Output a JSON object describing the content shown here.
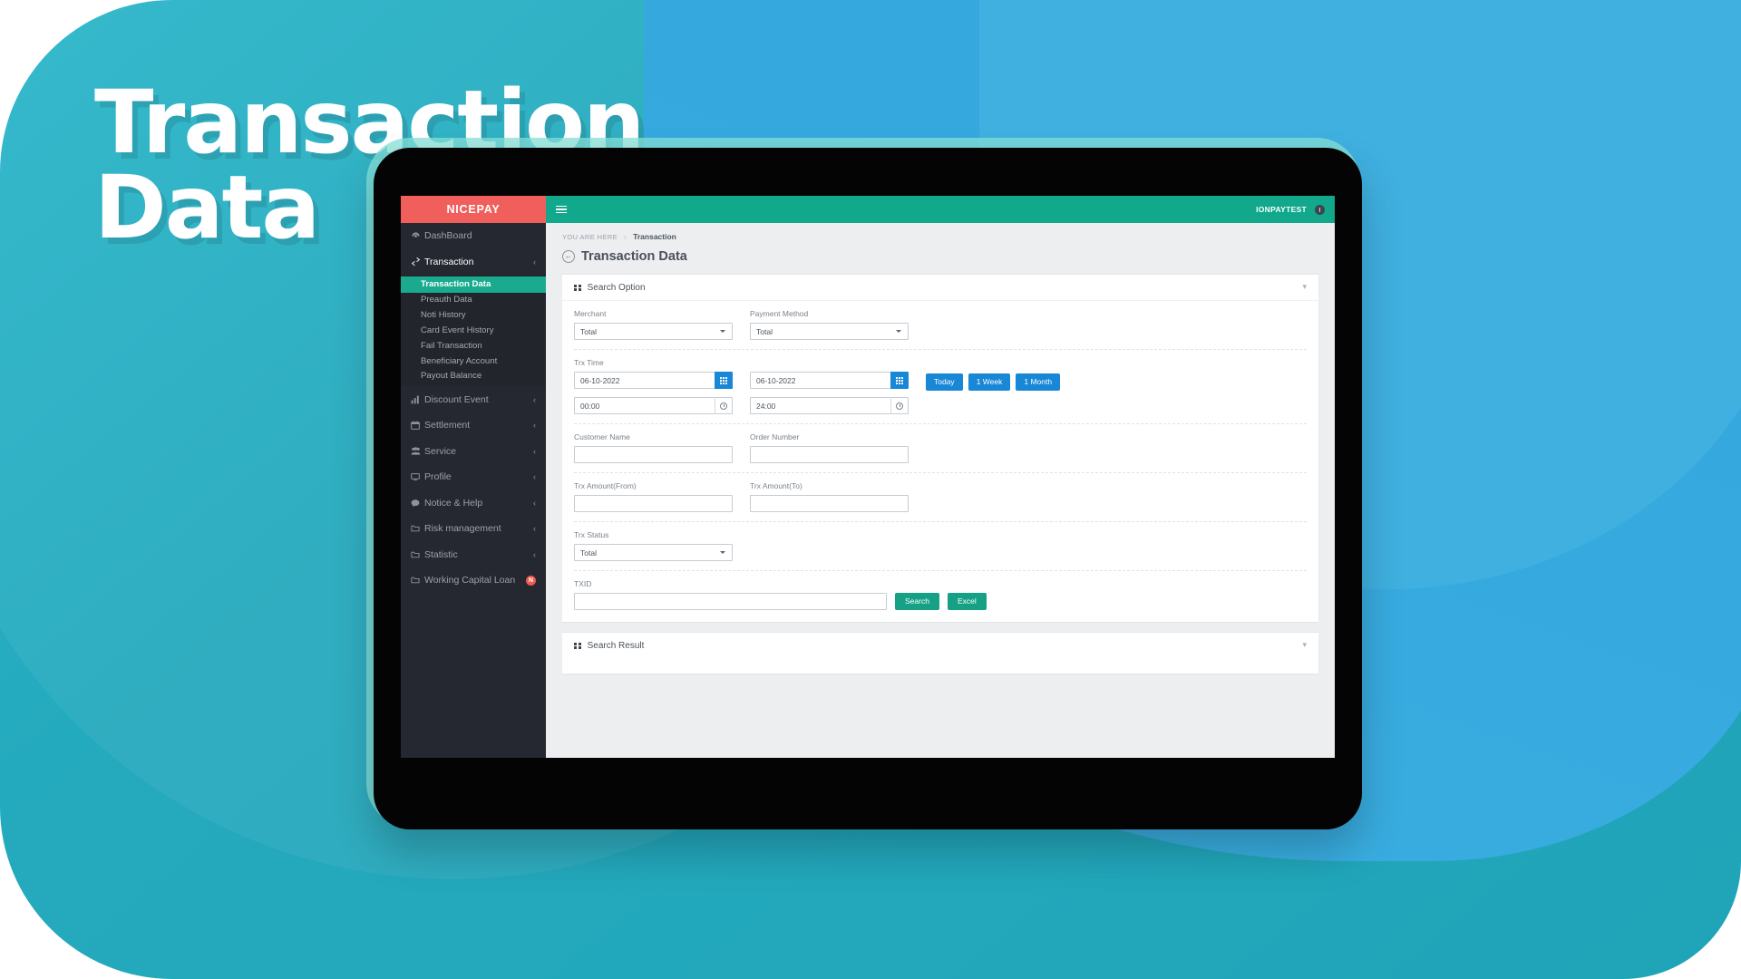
{
  "hero": {
    "line1": "Transaction",
    "line2": "Data"
  },
  "brand": {
    "name": "NICEPAY"
  },
  "topbar": {
    "menu_icon": "hamburger-icon",
    "user": "IONPAYTEST",
    "power_icon": "power-icon"
  },
  "sidebar": {
    "items": [
      {
        "label": "DashBoard",
        "icon": "dashboard-icon",
        "caret": ""
      },
      {
        "label": "Transaction",
        "icon": "transaction-icon",
        "caret": "‹"
      },
      {
        "label": "Discount Event",
        "icon": "chart-bar-icon",
        "caret": "‹"
      },
      {
        "label": "Settlement",
        "icon": "calendar-icon",
        "caret": "‹"
      },
      {
        "label": "Service",
        "icon": "users-icon",
        "caret": "‹"
      },
      {
        "label": "Profile",
        "icon": "monitor-icon",
        "caret": "‹"
      },
      {
        "label": "Notice & Help",
        "icon": "comment-icon",
        "caret": "‹"
      },
      {
        "label": "Risk management",
        "icon": "folder-icon",
        "caret": "‹"
      },
      {
        "label": "Statistic",
        "icon": "folder-icon",
        "caret": "‹"
      },
      {
        "label": "Working Capital Loan",
        "icon": "folder-icon",
        "caret": "",
        "badge": "N"
      }
    ],
    "submenu": [
      {
        "label": "Transaction Data",
        "selected": true
      },
      {
        "label": "Preauth Data",
        "selected": false
      },
      {
        "label": "Noti History",
        "selected": false
      },
      {
        "label": "Card Event History",
        "selected": false
      },
      {
        "label": "Fail Transaction",
        "selected": false
      },
      {
        "label": "Beneficiary Account",
        "selected": false
      },
      {
        "label": "Payout Balance",
        "selected": false
      }
    ]
  },
  "breadcrumb": {
    "prefix": "YOU ARE HERE",
    "separator": "›",
    "current": "Transaction"
  },
  "page": {
    "title": "Transaction Data",
    "back_icon": "arrow-left-circle-icon"
  },
  "search_option": {
    "title": "Search Option",
    "collapse_icon": "chevron-down-icon",
    "merchant": {
      "label": "Merchant",
      "value": "Total"
    },
    "payment_method": {
      "label": "Payment Method",
      "value": "Total"
    },
    "trx_time": {
      "label": "Trx Time",
      "date_from": "06-10-2022",
      "date_to": "06-10-2022",
      "time_from": "00:00",
      "time_to": "24:00",
      "calendar_icon": "calendar-icon",
      "clock_icon": "clock-icon",
      "quick_buttons": [
        "Today",
        "1 Week",
        "1 Month"
      ]
    },
    "customer_name": {
      "label": "Customer Name",
      "value": ""
    },
    "order_number": {
      "label": "Order Number",
      "value": ""
    },
    "trx_amount_from": {
      "label": "Trx Amount(From)",
      "value": ""
    },
    "trx_amount_to": {
      "label": "Trx Amount(To)",
      "value": ""
    },
    "trx_status": {
      "label": "Trx Status",
      "value": "Total"
    },
    "txid": {
      "label": "TXID",
      "value": ""
    },
    "actions": {
      "search": "Search",
      "excel": "Excel"
    }
  },
  "search_result": {
    "title": "Search Result",
    "collapse_icon": "chevron-down-icon"
  },
  "colors": {
    "brand_red": "#f15f5c",
    "topbar_green": "#11a88c",
    "accent_blue": "#1787d6",
    "button_green": "#16a085",
    "sidebar_dark": "#252830",
    "background_teal": "#22a7bb",
    "background_blue": "#3aaee0"
  }
}
